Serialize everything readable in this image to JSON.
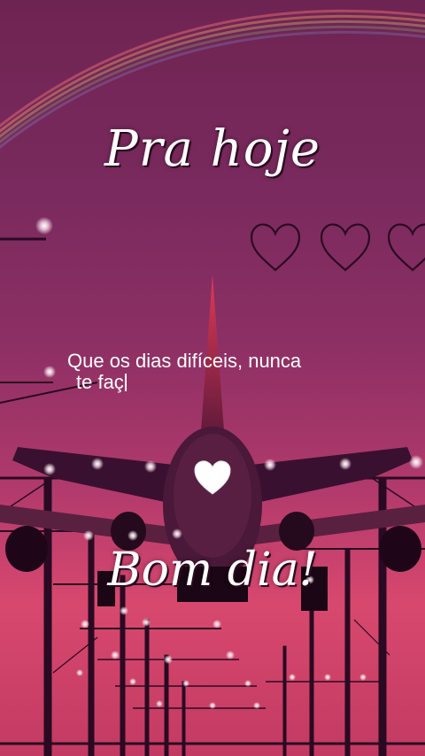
{
  "title": "Pra hoje",
  "message": {
    "line1": "Que os dias difíceis, nunca",
    "line2": "te faç"
  },
  "greeting": "Bom dia!",
  "decorations": {
    "outline_hearts": 3,
    "center_icon": "white-heart-icon",
    "rainbow": true
  },
  "colors": {
    "sky_top": "#6e2452",
    "sky_bottom": "#d8486e",
    "silhouette": "#2a0a22",
    "text": "#ffffff"
  }
}
